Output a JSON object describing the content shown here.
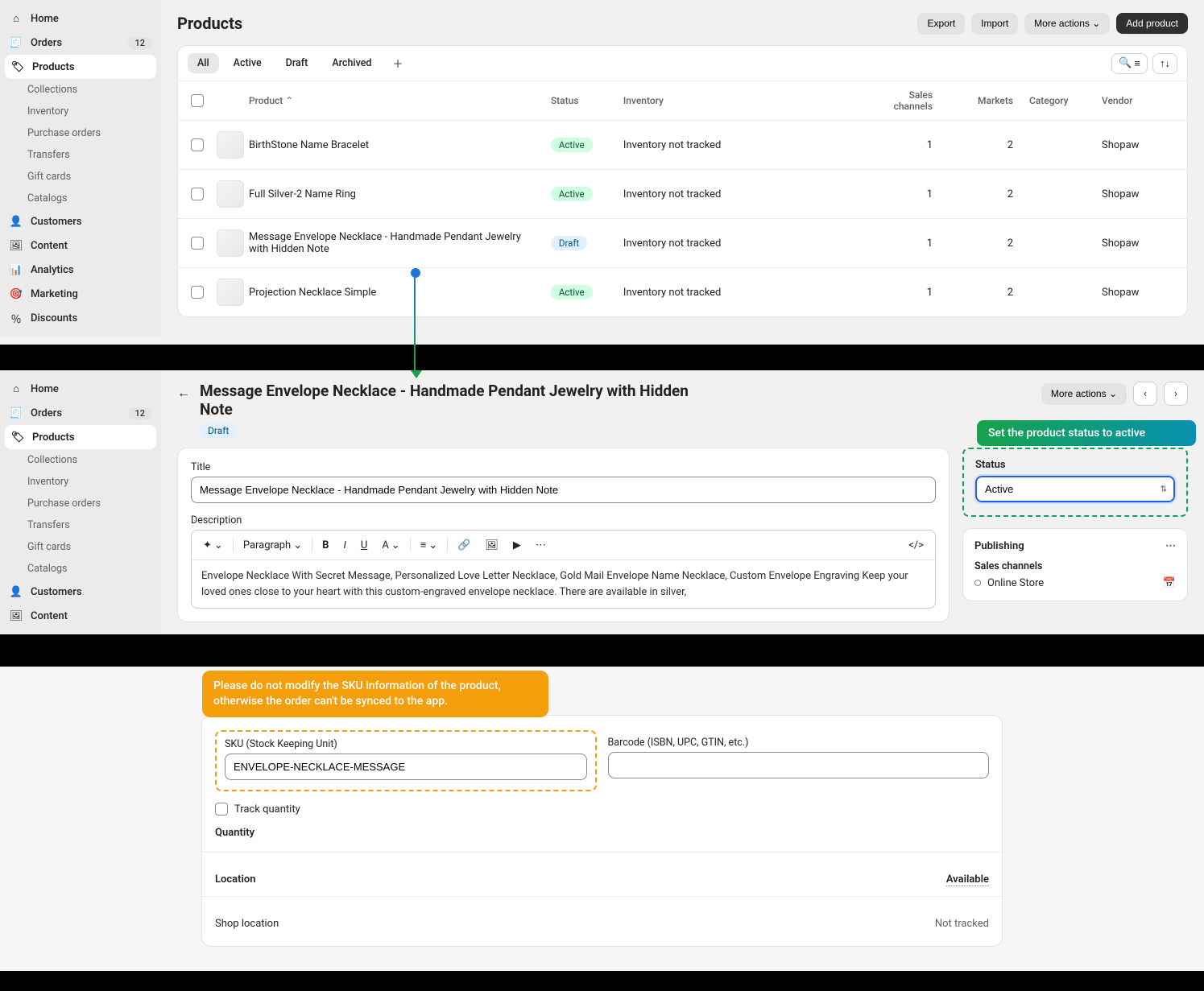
{
  "screen1": {
    "sidebar": {
      "items": [
        {
          "label": "Home",
          "icon": "home"
        },
        {
          "label": "Orders",
          "icon": "orders",
          "badge": "12"
        },
        {
          "label": "Products",
          "icon": "products",
          "active": true
        },
        {
          "label": "Customers",
          "icon": "customers"
        },
        {
          "label": "Content",
          "icon": "content"
        },
        {
          "label": "Analytics",
          "icon": "analytics"
        },
        {
          "label": "Marketing",
          "icon": "marketing"
        },
        {
          "label": "Discounts",
          "icon": "discounts"
        }
      ],
      "subs": [
        "Collections",
        "Inventory",
        "Purchase orders",
        "Transfers",
        "Gift cards",
        "Catalogs"
      ]
    },
    "title": "Products",
    "buttons": {
      "export": "Export",
      "import": "Import",
      "more": "More actions",
      "add": "Add product"
    },
    "tabs": [
      "All",
      "Active",
      "Draft",
      "Archived"
    ],
    "columns": {
      "product": "Product",
      "status": "Status",
      "inventory": "Inventory",
      "sales": "Sales channels",
      "markets": "Markets",
      "category": "Category",
      "vendor": "Vendor"
    },
    "rows": [
      {
        "name": "BirthStone Name Bracelet",
        "status": "Active",
        "inv": "Inventory not tracked",
        "sales": "1",
        "markets": "2",
        "vendor": "Shopaw"
      },
      {
        "name": "Full Silver-2 Name Ring",
        "status": "Active",
        "inv": "Inventory not tracked",
        "sales": "1",
        "markets": "2",
        "vendor": "Shopaw"
      },
      {
        "name": "Message Envelope Necklace - Handmade Pendant Jewelry with Hidden Note",
        "status": "Draft",
        "inv": "Inventory not tracked",
        "sales": "1",
        "markets": "2",
        "vendor": "Shopaw"
      },
      {
        "name": "Projection Necklace Simple",
        "status": "Active",
        "inv": "Inventory not tracked",
        "sales": "1",
        "markets": "2",
        "vendor": "Shopaw"
      }
    ]
  },
  "screen2": {
    "sidebar": {
      "items": [
        {
          "label": "Home"
        },
        {
          "label": "Orders",
          "badge": "12"
        },
        {
          "label": "Products",
          "active": true
        },
        {
          "label": "Customers"
        },
        {
          "label": "Content"
        }
      ],
      "subs": [
        "Collections",
        "Inventory",
        "Purchase orders",
        "Transfers",
        "Gift cards",
        "Catalogs"
      ]
    },
    "title": "Message Envelope Necklace - Handmade Pendant Jewelry with Hidden Note",
    "draft": "Draft",
    "more": "More actions",
    "form": {
      "titleLabel": "Title",
      "titleValue": "Message Envelope Necklace - Handmade Pendant Jewelry with Hidden Note",
      "descLabel": "Description",
      "paragraph": "Paragraph",
      "descText": "Envelope Necklace With Secret Message, Personalized Love Letter Necklace, Gold Mail Envelope Name Necklace, Custom Envelope Engraving Keep your loved ones close to your heart with this custom-engraved envelope necklace. There are available in silver,"
    },
    "calloutGreen": "Set the product status to active",
    "status": {
      "label": "Status",
      "value": "Active"
    },
    "publishing": {
      "title": "Publishing",
      "salesLabel": "Sales channels",
      "onlineStore": "Online Store"
    }
  },
  "screen3": {
    "callout": "Please do not modify the SKU information of the product, otherwise the order can't be synced to the app.",
    "skuLabel": "SKU (Stock Keeping Unit)",
    "skuValue": "ENVELOPE-NECKLACE-MESSAGE",
    "barcodeLabel": "Barcode (ISBN, UPC, GTIN, etc.)",
    "barcodeValue": "",
    "track": "Track quantity",
    "qty": "Quantity",
    "location": "Location",
    "available": "Available",
    "shopLocation": "Shop location",
    "notTracked": "Not tracked"
  }
}
